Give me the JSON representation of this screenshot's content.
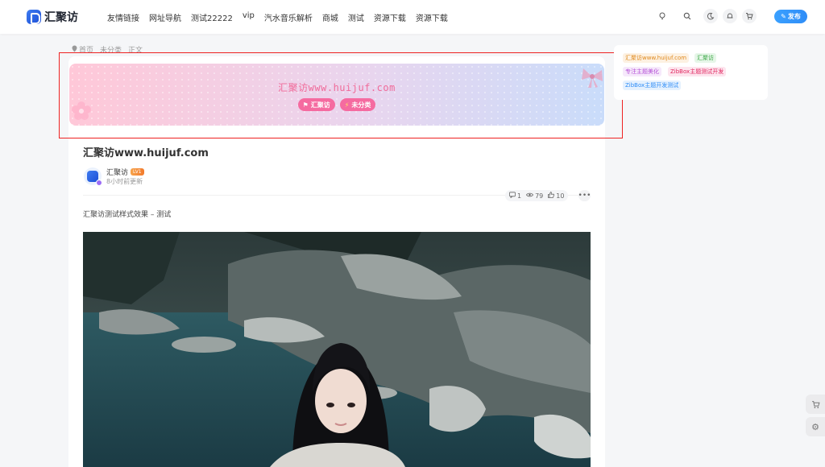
{
  "app": {
    "logo_text": "汇聚访"
  },
  "nav": {
    "items": [
      "友情链接",
      "网址导航",
      "测试22222",
      "vip",
      "汽水音乐解析",
      "商城",
      "测试",
      "资源下载",
      "资源下载"
    ]
  },
  "header": {
    "publish_label": "发布"
  },
  "breadcrumb": {
    "items": [
      "首页",
      "未分类",
      "正文"
    ]
  },
  "banner": {
    "title": "汇聚访www.huijuf.com",
    "tags": [
      "汇聚访",
      "未分类"
    ]
  },
  "post": {
    "title": "汇聚访www.huijuf.com",
    "author": "汇聚访",
    "level": "LV1",
    "updated": "8小时前更新",
    "comments": "1",
    "views": "79",
    "likes": "10",
    "excerpt": "汇聚访测试样式效果 – 测试"
  },
  "sidebar": {
    "tags": [
      {
        "label": "汇聚访www.huijuf.com",
        "color": "#e08a1e",
        "bg": "#fdf1e2"
      },
      {
        "label": "汇聚访",
        "color": "#3aa745",
        "bg": "#e6f6e8"
      },
      {
        "label": "专注主题美化",
        "color": "#b44fd6",
        "bg": "#f6e9fb"
      },
      {
        "label": "ZibBox主题测试开发",
        "color": "#e0245e",
        "bg": "#fde5ee"
      },
      {
        "label": "ZibBox主题开发测试",
        "color": "#2f8df7",
        "bg": "#e5f1fe"
      }
    ]
  },
  "colors": {
    "accent": "#2f8df7",
    "highlight_border": "#ee2222",
    "banner_tag": "#f56ba0"
  }
}
